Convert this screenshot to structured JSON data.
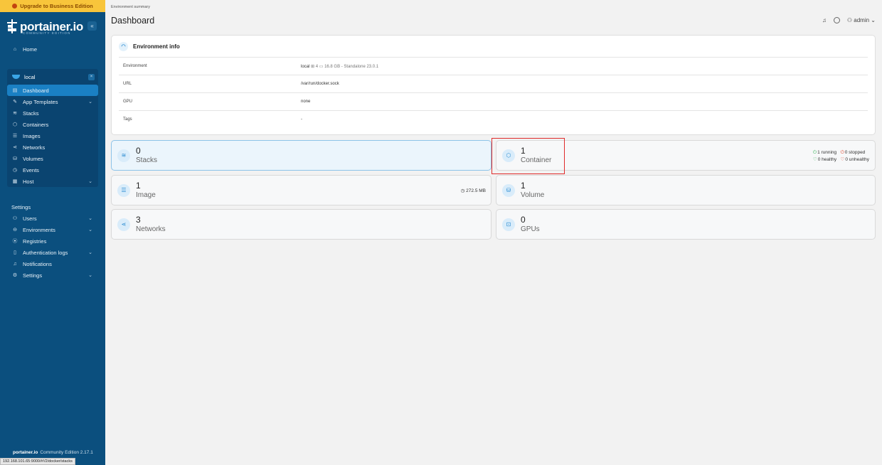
{
  "sidebar": {
    "upgrade_label": "Upgrade to Business Edition",
    "brand": "portainer.io",
    "brand_sub": "COMMUNITY EDITION",
    "collapse_symbol": "«",
    "home": {
      "icon": "home-icon",
      "label": "Home"
    },
    "environment": {
      "name": "local",
      "items": [
        {
          "icon": "dashboard-icon",
          "label": "Dashboard",
          "active": true
        },
        {
          "icon": "edit-icon",
          "label": "App Templates",
          "chevron": true
        },
        {
          "icon": "layers-icon",
          "label": "Stacks"
        },
        {
          "icon": "box-icon",
          "label": "Containers"
        },
        {
          "icon": "list-icon",
          "label": "Images"
        },
        {
          "icon": "share-icon",
          "label": "Networks"
        },
        {
          "icon": "database-icon",
          "label": "Volumes"
        },
        {
          "icon": "clock-icon",
          "label": "Events"
        },
        {
          "icon": "server-icon",
          "label": "Host",
          "chevron": true
        }
      ]
    },
    "settings_title": "Settings",
    "settings_items": [
      {
        "icon": "users-icon",
        "label": "Users",
        "chevron": true
      },
      {
        "icon": "hdd-icon",
        "label": "Environments",
        "chevron": true
      },
      {
        "icon": "radio-icon",
        "label": "Registries"
      },
      {
        "icon": "file-icon",
        "label": "Authentication logs",
        "chevron": true
      },
      {
        "icon": "bell-icon",
        "label": "Notifications"
      },
      {
        "icon": "gear-icon",
        "label": "Settings",
        "chevron": true
      }
    ],
    "footer_brand": "portainer.io",
    "footer_edition": "Community Edition 2.17.1",
    "status_url": "192.168.101.65:9000/#!/2/docker/stacks"
  },
  "header": {
    "breadcrumb": "Environment summary",
    "title": "Dashboard",
    "user": "admin"
  },
  "env_info": {
    "title": "Environment info",
    "rows": [
      {
        "key": "Environment",
        "value": "local",
        "extra": "4",
        "memory": "16.8 GB",
        "suffix": "- Standalone 23.0.1"
      },
      {
        "key": "URL",
        "value": "/var/run/docker.sock"
      },
      {
        "key": "GPU",
        "value": "none"
      },
      {
        "key": "Tags",
        "value": "-"
      }
    ]
  },
  "cards": {
    "stacks": {
      "count": "0",
      "label": "Stacks",
      "icon": "layers-icon"
    },
    "container": {
      "count": "1",
      "label": "Container",
      "icon": "box-icon",
      "running": "1 running",
      "stopped": "0 stopped",
      "healthy": "0 healthy",
      "unhealthy": "0 unhealthy"
    },
    "image": {
      "count": "1",
      "label": "Image",
      "icon": "list-icon",
      "size": "272.5 MB"
    },
    "volume": {
      "count": "1",
      "label": "Volume",
      "icon": "database-icon"
    },
    "networks": {
      "count": "3",
      "label": "Networks",
      "icon": "share-icon"
    },
    "gpus": {
      "count": "0",
      "label": "GPUs",
      "icon": "cpu-icon"
    }
  },
  "colors": {
    "sidebar_bg": "#0b4f7e",
    "upgrade_bg": "#f8c53b",
    "active_item": "#1a80c4",
    "highlight": "#e02b2b"
  }
}
